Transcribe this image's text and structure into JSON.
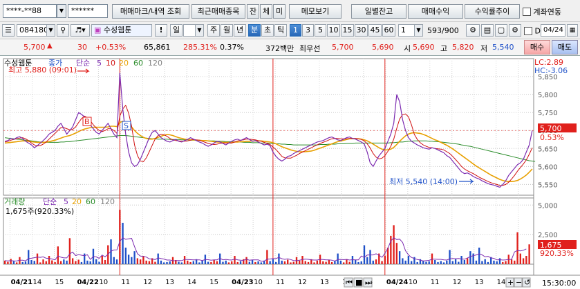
{
  "toolbar1": {
    "account_field": "****-**88",
    "password_field": "******",
    "trade_mark_button": "매매마크/내역 조회",
    "recent_items_button": "최근매매종목",
    "balance_tab": "잔",
    "executed_tab": "체",
    "pending_tab": "미",
    "memo_button": "메모보기",
    "daily_balance_button": "일별잔고",
    "trade_profit_button": "매매수익",
    "return_trend_button": "수익률추이",
    "account_link_label": "계좌연동"
  },
  "toolbar2": {
    "stock_code": "084180",
    "stock_name": "수성웹툰",
    "exclaim": "!",
    "period_day": "일",
    "period_num": "1",
    "week": "주",
    "month": "월",
    "year": "년",
    "minute": "분",
    "second": "초",
    "tick": "틱",
    "intervals": [
      "1",
      "3",
      "5",
      "10",
      "15",
      "30",
      "45",
      "60"
    ],
    "interval_value": "1",
    "count_display": "593/900",
    "d_label": "D",
    "date_value": "04/24"
  },
  "quote": {
    "price": "5,700",
    "change": "30",
    "change_pct": "+0.53%",
    "volume": "65,861",
    "volume_ratio": "285.31%",
    "turnover": "0.37%",
    "amount": "372백만",
    "best_bid_label": "최우선",
    "best_ask": "5,700",
    "best_bid": "5,690",
    "open_label": "시",
    "open": "5,690",
    "high_label": "고",
    "high": "5,820",
    "low_label": "저",
    "low": "5,540",
    "buy_button": "매수",
    "sell_button": "매도"
  },
  "colors": {
    "up": "#e0201c",
    "down": "#1e50c8",
    "ma5": "#7b2ab0",
    "ma10": "#d01010",
    "ma20": "#e8a000",
    "ma60": "#2a8c2a",
    "ma120": "#808080"
  },
  "chart_data": {
    "type": "line",
    "price_panel": {
      "legend": {
        "name": "수성웹툰",
        "type": "종가",
        "ma_type": "단순",
        "periods": [
          "5",
          "10",
          "20",
          "60",
          "120"
        ]
      },
      "lc": "LC:2.89",
      "hc": "HC:-3.06",
      "high_annotation": "최고 5,880 (09:01)",
      "low_annotation": "최저 5,540 (14:00)",
      "yticks": [
        5850,
        5800,
        5750,
        5700,
        5650,
        5600,
        5550
      ],
      "ytick_labels": [
        "5,850",
        "5,800",
        "5,750",
        "5,700",
        "5,650",
        "5,600",
        "5,550"
      ],
      "ylim": [
        5520,
        5900
      ],
      "current_price_label": "5,700",
      "current_pct_label": "0.53%",
      "markers": [
        "B",
        "S"
      ],
      "close": [
        5670,
        5672,
        5678,
        5675,
        5680,
        5683,
        5678,
        5670,
        5665,
        5660,
        5652,
        5658,
        5665,
        5672,
        5680,
        5690,
        5695,
        5700,
        5712,
        5720,
        5705,
        5690,
        5700,
        5710,
        5730,
        5750,
        5745,
        5738,
        5722,
        5715,
        5705,
        5695,
        5690,
        5700,
        5710,
        5720,
        5705,
        5690,
        5680,
        5860,
        5760,
        5690,
        5640,
        5610,
        5600,
        5605,
        5620,
        5640,
        5660,
        5680,
        5695,
        5700,
        5690,
        5680,
        5675,
        5670,
        5668,
        5672,
        5675,
        5670,
        5668,
        5672,
        5675,
        5680,
        5676,
        5672,
        5668,
        5665,
        5660,
        5656,
        5660,
        5665,
        5670,
        5668,
        5664,
        5660,
        5665,
        5670,
        5674,
        5676,
        5672,
        5676,
        5680,
        5675,
        5670,
        5672,
        5668,
        5664,
        5660,
        5662,
        5658,
        5640,
        5628,
        5620,
        5615,
        5620,
        5628,
        5630,
        5636,
        5640,
        5644,
        5648,
        5652,
        5656,
        5660,
        5664,
        5668,
        5670,
        5672,
        5676,
        5680,
        5682,
        5678,
        5674,
        5672,
        5676,
        5680,
        5682,
        5678,
        5676,
        5672,
        5668,
        5662,
        5640,
        5610,
        5600,
        5615,
        5630,
        5640,
        5650,
        5670,
        5690,
        5720,
        5800,
        5780,
        5730,
        5700,
        5680,
        5670,
        5665,
        5660,
        5656,
        5652,
        5650,
        5648,
        5652,
        5650,
        5646,
        5642,
        5638,
        5630,
        5625,
        5615,
        5605,
        5595,
        5585,
        5580,
        5582,
        5578,
        5572,
        5568,
        5565,
        5560,
        5556,
        5552,
        5550,
        5548,
        5545,
        5542,
        5550,
        5560,
        5575,
        5585,
        5595,
        5605,
        5610,
        5620,
        5640,
        5660,
        5700
      ],
      "ma5": [
        5668,
        5670,
        5673,
        5675,
        5677,
        5679,
        5680,
        5677,
        5672,
        5665,
        5660,
        5657,
        5658,
        5662,
        5668,
        5676,
        5684,
        5692,
        5700,
        5708,
        5708,
        5705,
        5702,
        5703,
        5710,
        5722,
        5733,
        5740,
        5736,
        5727,
        5716,
        5707,
        5700,
        5697,
        5700,
        5705,
        5705,
        5700,
        5692,
        5740,
        5760,
        5770,
        5748,
        5712,
        5660,
        5630,
        5615,
        5613,
        5624,
        5641,
        5659,
        5676,
        5686,
        5690,
        5688,
        5684,
        5678,
        5674,
        5672,
        5671,
        5670,
        5670,
        5671,
        5673,
        5675,
        5674,
        5673,
        5670,
        5667,
        5664,
        5662,
        5661,
        5662,
        5664,
        5665,
        5665,
        5665,
        5665,
        5668,
        5671,
        5673,
        5674,
        5676,
        5676,
        5675,
        5674,
        5672,
        5670,
        5667,
        5664,
        5661,
        5654,
        5647,
        5638,
        5628,
        5624,
        5623,
        5623,
        5627,
        5631,
        5636,
        5640,
        5644,
        5648,
        5652,
        5656,
        5660,
        5664,
        5667,
        5670,
        5674,
        5677,
        5678,
        5678,
        5677,
        5677,
        5677,
        5678,
        5678,
        5678,
        5677,
        5675,
        5671,
        5663,
        5651,
        5636,
        5626,
        5621,
        5623,
        5630,
        5642,
        5656,
        5676,
        5706,
        5732,
        5744,
        5746,
        5738,
        5716,
        5689,
        5675,
        5666,
        5660,
        5656,
        5653,
        5652,
        5650,
        5649,
        5648,
        5646,
        5641,
        5636,
        5628,
        5619,
        5610,
        5600,
        5593,
        5588,
        5584,
        5580,
        5575,
        5570,
        5566,
        5562,
        5558,
        5555,
        5552,
        5550,
        5547,
        5547,
        5550,
        5556,
        5565,
        5575,
        5587,
        5597,
        5607,
        5618,
        5634,
        5652
      ],
      "ma20": [
        5665,
        5666,
        5667,
        5668,
        5669,
        5670,
        5671,
        5671,
        5670,
        5669,
        5668,
        5667,
        5667,
        5667,
        5668,
        5669,
        5671,
        5673,
        5676,
        5679,
        5682,
        5684,
        5686,
        5689,
        5693,
        5697,
        5701,
        5704,
        5706,
        5708,
        5709,
        5709,
        5709,
        5709,
        5709,
        5710,
        5712,
        5712,
        5711,
        5722,
        5726,
        5724,
        5718,
        5710,
        5700,
        5692,
        5686,
        5681,
        5678,
        5676,
        5676,
        5678,
        5681,
        5684,
        5687,
        5689,
        5688,
        5686,
        5683,
        5680,
        5678,
        5676,
        5675,
        5674,
        5674,
        5673,
        5673,
        5672,
        5672,
        5671,
        5670,
        5669,
        5668,
        5668,
        5667,
        5667,
        5667,
        5667,
        5668,
        5668,
        5669,
        5669,
        5670,
        5670,
        5671,
        5671,
        5671,
        5671,
        5670,
        5669,
        5668,
        5666,
        5663,
        5659,
        5655,
        5652,
        5649,
        5646,
        5644,
        5642,
        5641,
        5641,
        5641,
        5642,
        5643,
        5645,
        5648,
        5651,
        5654,
        5657,
        5660,
        5663,
        5666,
        5669,
        5671,
        5673,
        5675,
        5677,
        5677,
        5677,
        5677,
        5676,
        5674,
        5671,
        5667,
        5662,
        5657,
        5652,
        5648,
        5646,
        5646,
        5648,
        5653,
        5661,
        5670,
        5678,
        5685,
        5690,
        5693,
        5694,
        5693,
        5692,
        5689,
        5686,
        5682,
        5678,
        5674,
        5671,
        5667,
        5663,
        5659,
        5654,
        5649,
        5643,
        5637,
        5631,
        5625,
        5619,
        5613,
        5607,
        5601,
        5596,
        5591,
        5586,
        5581,
        5576,
        5572,
        5568,
        5564,
        5561,
        5559,
        5558,
        5558,
        5559,
        5561,
        5565,
        5570,
        5576,
        5584,
        5593
      ],
      "ma60": [
        5680,
        5679,
        5678,
        5677,
        5676,
        5675,
        5674,
        5673,
        5672,
        5671,
        5670,
        5669,
        5668,
        5668,
        5667,
        5667,
        5667,
        5667,
        5667,
        5668,
        5668,
        5669,
        5669,
        5670,
        5671,
        5672,
        5673,
        5674,
        5675,
        5676,
        5677,
        5678,
        5679,
        5680,
        5681,
        5682,
        5683,
        5684,
        5685,
        5686,
        5686,
        5686,
        5685,
        5684,
        5683,
        5682,
        5681,
        5680,
        5679,
        5678,
        5677,
        5677,
        5676,
        5676,
        5676,
        5676,
        5675,
        5675,
        5675,
        5675,
        5674,
        5674,
        5674,
        5673,
        5673,
        5673,
        5672,
        5672,
        5672,
        5671,
        5671,
        5671,
        5670,
        5670,
        5670,
        5669,
        5669,
        5669,
        5668,
        5668,
        5668,
        5667,
        5667,
        5667,
        5666,
        5666,
        5666,
        5665,
        5665,
        5665,
        5664,
        5664,
        5663,
        5663,
        5662,
        5662,
        5661,
        5661,
        5660,
        5660,
        5660,
        5660,
        5660,
        5660,
        5660,
        5660,
        5660,
        5661,
        5661,
        5661,
        5662,
        5662,
        5662,
        5663,
        5663,
        5663,
        5664,
        5664,
        5664,
        5665,
        5665,
        5665,
        5665,
        5665,
        5665,
        5665,
        5665,
        5665,
        5665,
        5665,
        5665,
        5666,
        5666,
        5667,
        5668,
        5668,
        5669,
        5670,
        5670,
        5671,
        5671,
        5671,
        5671,
        5671,
        5670,
        5670,
        5669,
        5669,
        5668,
        5667,
        5666,
        5665,
        5664,
        5663,
        5662,
        5660,
        5659,
        5657,
        5656,
        5654,
        5652,
        5650,
        5648,
        5646,
        5644,
        5642,
        5640,
        5638,
        5636,
        5634,
        5632,
        5630,
        5628,
        5626,
        5624,
        5622,
        5620,
        5618,
        5616,
        5615,
        5614
      ]
    },
    "volume_panel": {
      "legend": {
        "name": "거래량",
        "ma_type": "단순",
        "periods": [
          "5",
          "20",
          "60",
          "120"
        ]
      },
      "value_label": "1,675주(920.33%)",
      "yticks": [
        5000,
        2500
      ],
      "ytick_labels": [
        "5,000",
        "2,500"
      ],
      "ylim": [
        0,
        5600
      ],
      "current_volume_label": "1,675",
      "current_pct_label": "920.33%",
      "volume": [
        300,
        200,
        450,
        250,
        150,
        600,
        180,
        220,
        1200,
        350,
        280,
        900,
        150,
        400,
        250,
        700,
        320,
        180,
        1500,
        260,
        400,
        300,
        2200,
        500,
        260,
        380,
        180,
        900,
        300,
        240,
        1300,
        420,
        200,
        700,
        350,
        1600,
        2100,
        600,
        400,
        4600,
        3500,
        1400,
        800,
        600,
        1100,
        500,
        400,
        700,
        300,
        260,
        500,
        200,
        900,
        300,
        150,
        180,
        240,
        600,
        350,
        200,
        150,
        700,
        300,
        180,
        260,
        420,
        150,
        300,
        800,
        200,
        180,
        350,
        250,
        900,
        200,
        300,
        150,
        240,
        700,
        180,
        260,
        420,
        600,
        200,
        350,
        180,
        240,
        150,
        300,
        1200,
        260,
        420,
        180,
        900,
        300,
        240,
        380,
        150,
        200,
        600,
        300,
        700,
        260,
        180,
        420,
        150,
        300,
        800,
        240,
        200,
        350,
        180,
        260,
        900,
        300,
        150,
        420,
        200,
        700,
        350,
        180,
        240,
        1600,
        600,
        1200,
        300,
        400,
        900,
        260,
        700,
        1400,
        2400,
        3300,
        1800,
        1100,
        500,
        300,
        700,
        260,
        600,
        180,
        420,
        300,
        200,
        240,
        900,
        350,
        180,
        260,
        150,
        300,
        1200,
        260,
        420,
        200,
        700,
        350,
        500,
        1100,
        900,
        300,
        1400,
        260,
        420,
        180,
        600,
        300,
        240,
        500,
        180,
        260,
        800,
        420,
        300,
        2700,
        900,
        500,
        700,
        1675
      ],
      "ma5": [
        300,
        280,
        300,
        280,
        270,
        330,
        330,
        280,
        470,
        500,
        550,
        600,
        580,
        620,
        500,
        480,
        440,
        360,
        700,
        590,
        530,
        530,
        870,
        1020,
        730,
        810,
        760,
        720,
        800,
        400,
        650,
        620,
        490,
        770,
        620,
        840,
        1100,
        1200,
        1210,
        1920,
        2240,
        2100,
        2140,
        2180,
        1480,
        880,
        680,
        660,
        600,
        450,
        430,
        390,
        530,
        470,
        430,
        350,
        350,
        290,
        300,
        310,
        300,
        400,
        390,
        380,
        360,
        360,
        370,
        310,
        390,
        380,
        330,
        370,
        370,
        500,
        370,
        400,
        360,
        350,
        440,
        370,
        340,
        320,
        430,
        330,
        370,
        370,
        370,
        250,
        250,
        420,
        440,
        470,
        470,
        570,
        460,
        410,
        450,
        390,
        310,
        300,
        330,
        390,
        430,
        410,
        370,
        350,
        350,
        410,
        390,
        360,
        370,
        340,
        260,
        390,
        400,
        380,
        400,
        350,
        380,
        360,
        360,
        690,
        580,
        770,
        780,
        780,
        880,
        760,
        580,
        930,
        1340,
        1960,
        2230,
        2080,
        2120,
        1840,
        1140,
        790,
        570,
        480,
        390,
        350,
        270,
        300,
        320,
        420,
        420,
        410,
        410,
        360,
        350,
        450,
        480,
        460,
        480,
        440,
        420,
        520,
        640,
        720,
        780,
        880,
        790,
        620,
        660,
        530,
        490,
        360,
        380,
        350,
        370,
        400,
        400,
        1040,
        1160,
        1120,
        1180,
        1290
      ]
    },
    "x_labels": [
      "04/21",
      "14",
      "15",
      "04/22",
      "10",
      "11",
      "12",
      "13",
      "14",
      "15",
      "04/23",
      "10",
      "11",
      "12",
      "13",
      "14",
      "15",
      "04/24",
      "10",
      "11",
      "12",
      "13",
      "14",
      "15"
    ],
    "date_labels": [
      "04/21",
      "04/22",
      "04/23",
      "04/24"
    ],
    "session_separators": [
      39,
      91,
      129
    ],
    "time_display": "15:30:00"
  }
}
